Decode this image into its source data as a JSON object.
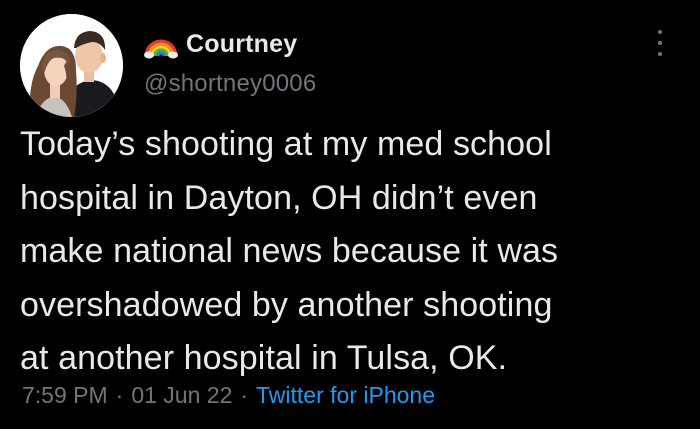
{
  "author": {
    "display_name": "Courtney",
    "handle": "@shortney0006",
    "emoji": "rainbow-emoji",
    "avatar": "couple-illustration-avatar"
  },
  "tweet": {
    "lines": [
      "Today’s shooting at my med school",
      "hospital in Dayton, OH didn’t even",
      "make national news because it was",
      "overshadowed by another shooting",
      "at another hospital in Tulsa, OK."
    ]
  },
  "meta": {
    "time": "7:59 PM",
    "date": "01 Jun 22",
    "separator": "·",
    "source": "Twitter for iPhone"
  },
  "icons": {
    "more": "more-options-icon"
  },
  "colors": {
    "background": "#000000",
    "primary_text": "#e7e9ea",
    "secondary_text": "#71767b",
    "link": "#1d9bf0"
  }
}
